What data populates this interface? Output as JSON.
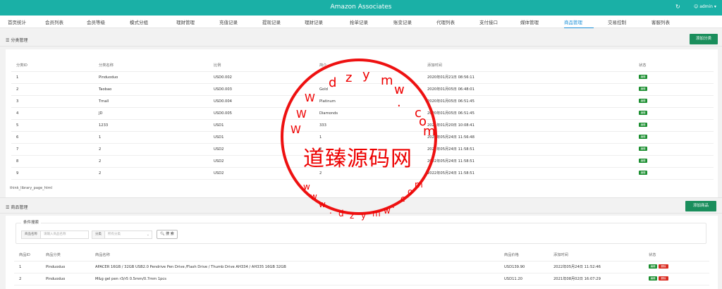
{
  "app_title": "Amazon Associates",
  "user": {
    "name": "admin"
  },
  "nav_tabs": [
    "首页统计",
    "会员列表",
    "会员等级",
    "模式分组",
    "理财管理",
    "充值记录",
    "提现记录",
    "理财记录",
    "抢单记录",
    "账变记录",
    "代理列表",
    "支付接口",
    "媒体管理",
    "商品管理",
    "交易控制",
    "客服列表"
  ],
  "active_tab": "商品管理",
  "category_section": {
    "title": "分类管理",
    "add_button": "添加分类",
    "columns": [
      "分类ID",
      "分类名称",
      "比例",
      "简介",
      "添加时间",
      "状态"
    ],
    "rows": [
      [
        "1",
        "Pinduoduo",
        "USD0.002",
        "",
        "2020年01月21日 08:56:11",
        "编辑"
      ],
      [
        "2",
        "Taobao",
        "USD0.003",
        "Gold",
        "2020年01月05日 06:48:01",
        "编辑"
      ],
      [
        "3",
        "Tmall",
        "USD0.004",
        "Platinum",
        "2020年01月05日 06:51:45",
        "编辑"
      ],
      [
        "4",
        "JD",
        "USD0.005",
        "Diamonds",
        "2020年01月05日 06:51:45",
        "编辑"
      ],
      [
        "5",
        "1233",
        "USD1",
        "333",
        "2021年01月20日 10:08:41",
        "编辑"
      ],
      [
        "6",
        "1",
        "USD1",
        "1",
        "2022年05月24日 11:56:48",
        "编辑"
      ],
      [
        "7",
        "2",
        "USD2",
        "2",
        "2022年05月24日 11:58:51",
        "编辑"
      ],
      [
        "8",
        "2",
        "USD2",
        "2",
        "2022年05月24日 11:58:51",
        "编辑"
      ],
      [
        "9",
        "2",
        "USD2",
        "2",
        "2022年05月24日 11:58:51",
        "编辑"
      ]
    ],
    "pagination_text": "think_library_page_html"
  },
  "product_section": {
    "title": "商品管理",
    "add_button": "添加商品",
    "search": {
      "legend": "条件搜索",
      "name_label": "商品名称",
      "name_placeholder": "请输入商品名称",
      "category_label": "分类",
      "category_value": "所有分类",
      "button": "搜 索"
    },
    "columns": [
      "商品ID",
      "商品分类",
      "商品名称",
      "商品价格",
      "添加时间",
      "状态"
    ],
    "rows": [
      [
        "1",
        "Pinduoduo",
        "APACER 16GB / 32GB USB2.0 Pendrive Pen Drive /Flash Drive / Thumb Drive AH334 / AH335 16GB 32GB",
        "USD139.90",
        "2022年05月24日 11:52:46"
      ],
      [
        "2",
        "Pinduoduo",
        "M&g gel pen r3/r5 0.5mm/0.7mm 1pcs",
        "USD11.20",
        "2021年08月02日 16:07:29"
      ]
    ],
    "edit_label": "编辑",
    "delete_label": "删除"
  },
  "watermark": {
    "text": "道臻源码网",
    "url_upper": [
      "d",
      "z",
      "y",
      "m",
      "w",
      ".",
      "c",
      "o",
      "m"
    ],
    "url_lower": "w w w . d z y m w . c o m",
    "www_left": [
      "W",
      "W",
      "W"
    ]
  }
}
